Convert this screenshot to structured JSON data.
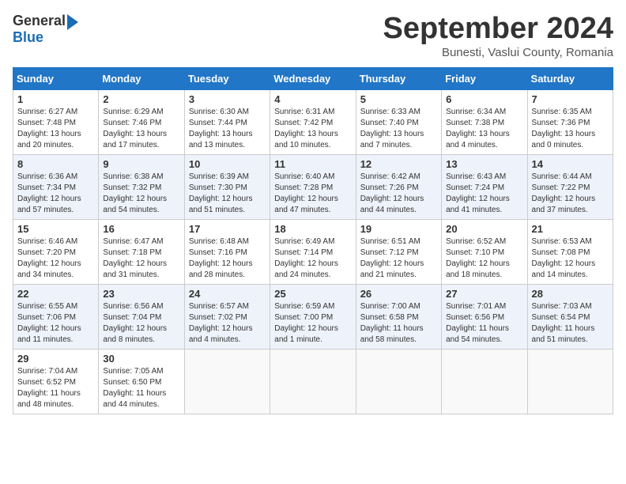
{
  "header": {
    "logo_general": "General",
    "logo_blue": "Blue",
    "month_title": "September 2024",
    "location": "Bunesti, Vaslui County, Romania"
  },
  "calendar": {
    "days_of_week": [
      "Sunday",
      "Monday",
      "Tuesday",
      "Wednesday",
      "Thursday",
      "Friday",
      "Saturday"
    ],
    "weeks": [
      [
        {
          "day": "1",
          "sunrise": "6:27 AM",
          "sunset": "7:48 PM",
          "daylight": "13 hours and 20 minutes."
        },
        {
          "day": "2",
          "sunrise": "6:29 AM",
          "sunset": "7:46 PM",
          "daylight": "13 hours and 17 minutes."
        },
        {
          "day": "3",
          "sunrise": "6:30 AM",
          "sunset": "7:44 PM",
          "daylight": "13 hours and 13 minutes."
        },
        {
          "day": "4",
          "sunrise": "6:31 AM",
          "sunset": "7:42 PM",
          "daylight": "13 hours and 10 minutes."
        },
        {
          "day": "5",
          "sunrise": "6:33 AM",
          "sunset": "7:40 PM",
          "daylight": "13 hours and 7 minutes."
        },
        {
          "day": "6",
          "sunrise": "6:34 AM",
          "sunset": "7:38 PM",
          "daylight": "13 hours and 4 minutes."
        },
        {
          "day": "7",
          "sunrise": "6:35 AM",
          "sunset": "7:36 PM",
          "daylight": "13 hours and 0 minutes."
        }
      ],
      [
        {
          "day": "8",
          "sunrise": "6:36 AM",
          "sunset": "7:34 PM",
          "daylight": "12 hours and 57 minutes."
        },
        {
          "day": "9",
          "sunrise": "6:38 AM",
          "sunset": "7:32 PM",
          "daylight": "12 hours and 54 minutes."
        },
        {
          "day": "10",
          "sunrise": "6:39 AM",
          "sunset": "7:30 PM",
          "daylight": "12 hours and 51 minutes."
        },
        {
          "day": "11",
          "sunrise": "6:40 AM",
          "sunset": "7:28 PM",
          "daylight": "12 hours and 47 minutes."
        },
        {
          "day": "12",
          "sunrise": "6:42 AM",
          "sunset": "7:26 PM",
          "daylight": "12 hours and 44 minutes."
        },
        {
          "day": "13",
          "sunrise": "6:43 AM",
          "sunset": "7:24 PM",
          "daylight": "12 hours and 41 minutes."
        },
        {
          "day": "14",
          "sunrise": "6:44 AM",
          "sunset": "7:22 PM",
          "daylight": "12 hours and 37 minutes."
        }
      ],
      [
        {
          "day": "15",
          "sunrise": "6:46 AM",
          "sunset": "7:20 PM",
          "daylight": "12 hours and 34 minutes."
        },
        {
          "day": "16",
          "sunrise": "6:47 AM",
          "sunset": "7:18 PM",
          "daylight": "12 hours and 31 minutes."
        },
        {
          "day": "17",
          "sunrise": "6:48 AM",
          "sunset": "7:16 PM",
          "daylight": "12 hours and 28 minutes."
        },
        {
          "day": "18",
          "sunrise": "6:49 AM",
          "sunset": "7:14 PM",
          "daylight": "12 hours and 24 minutes."
        },
        {
          "day": "19",
          "sunrise": "6:51 AM",
          "sunset": "7:12 PM",
          "daylight": "12 hours and 21 minutes."
        },
        {
          "day": "20",
          "sunrise": "6:52 AM",
          "sunset": "7:10 PM",
          "daylight": "12 hours and 18 minutes."
        },
        {
          "day": "21",
          "sunrise": "6:53 AM",
          "sunset": "7:08 PM",
          "daylight": "12 hours and 14 minutes."
        }
      ],
      [
        {
          "day": "22",
          "sunrise": "6:55 AM",
          "sunset": "7:06 PM",
          "daylight": "12 hours and 11 minutes."
        },
        {
          "day": "23",
          "sunrise": "6:56 AM",
          "sunset": "7:04 PM",
          "daylight": "12 hours and 8 minutes."
        },
        {
          "day": "24",
          "sunrise": "6:57 AM",
          "sunset": "7:02 PM",
          "daylight": "12 hours and 4 minutes."
        },
        {
          "day": "25",
          "sunrise": "6:59 AM",
          "sunset": "7:00 PM",
          "daylight": "12 hours and 1 minute."
        },
        {
          "day": "26",
          "sunrise": "7:00 AM",
          "sunset": "6:58 PM",
          "daylight": "11 hours and 58 minutes."
        },
        {
          "day": "27",
          "sunrise": "7:01 AM",
          "sunset": "6:56 PM",
          "daylight": "11 hours and 54 minutes."
        },
        {
          "day": "28",
          "sunrise": "7:03 AM",
          "sunset": "6:54 PM",
          "daylight": "11 hours and 51 minutes."
        }
      ],
      [
        {
          "day": "29",
          "sunrise": "7:04 AM",
          "sunset": "6:52 PM",
          "daylight": "11 hours and 48 minutes."
        },
        {
          "day": "30",
          "sunrise": "7:05 AM",
          "sunset": "6:50 PM",
          "daylight": "11 hours and 44 minutes."
        },
        null,
        null,
        null,
        null,
        null
      ]
    ]
  }
}
